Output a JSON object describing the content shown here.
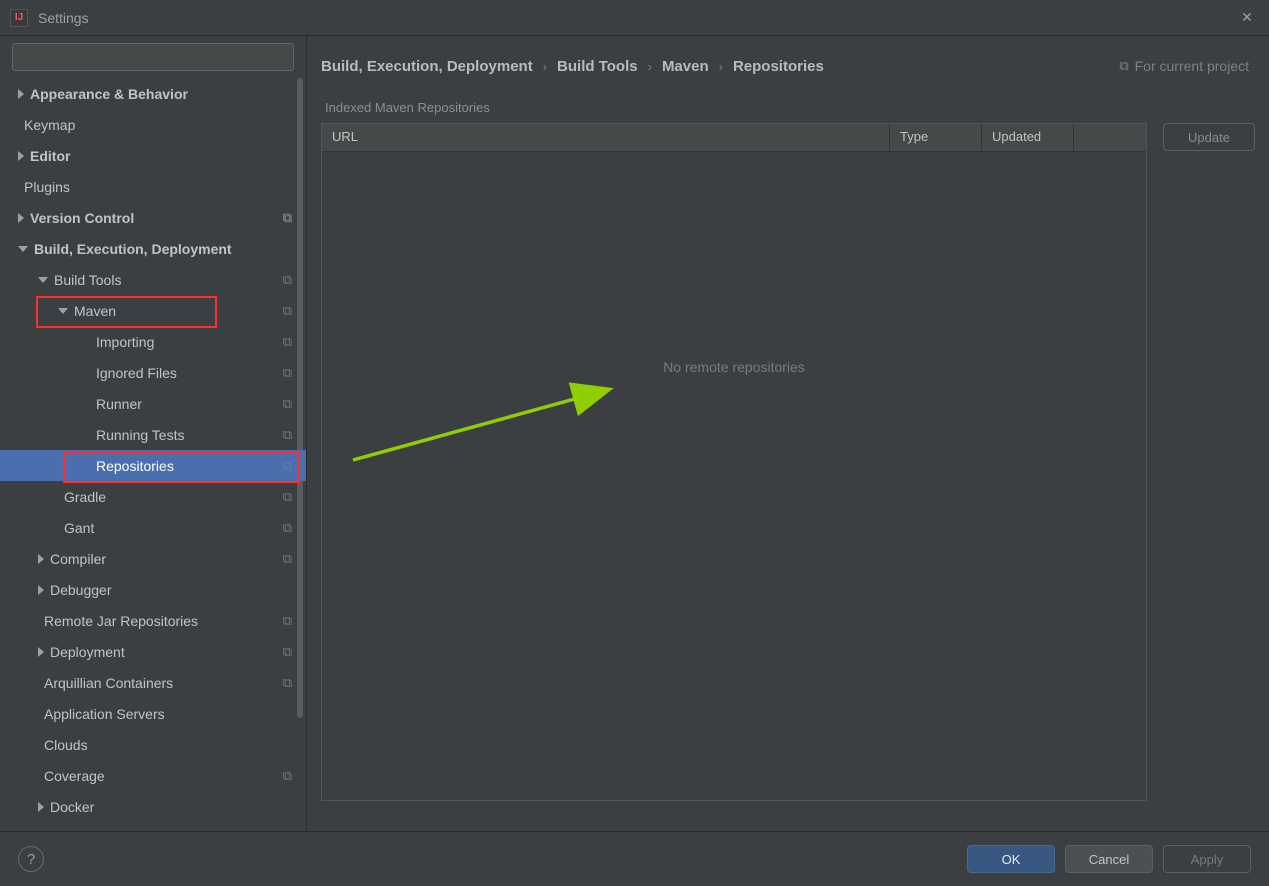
{
  "window": {
    "title": "Settings"
  },
  "search": {
    "placeholder": ""
  },
  "tree": {
    "appearance": "Appearance & Behavior",
    "keymap": "Keymap",
    "editor": "Editor",
    "plugins": "Plugins",
    "vcs": "Version Control",
    "bed": "Build, Execution, Deployment",
    "build_tools": "Build Tools",
    "maven": "Maven",
    "importing": "Importing",
    "ignored": "Ignored Files",
    "runner": "Runner",
    "running_tests": "Running Tests",
    "repositories": "Repositories",
    "gradle": "Gradle",
    "gant": "Gant",
    "compiler": "Compiler",
    "debugger": "Debugger",
    "remote_jar": "Remote Jar Repositories",
    "deployment": "Deployment",
    "arquillian": "Arquillian Containers",
    "app_servers": "Application Servers",
    "clouds": "Clouds",
    "coverage": "Coverage",
    "docker": "Docker"
  },
  "breadcrumbs": {
    "a": "Build, Execution, Deployment",
    "b": "Build Tools",
    "c": "Maven",
    "d": "Repositories",
    "for_project": "For current project"
  },
  "section_title": "Indexed Maven Repositories",
  "columns": {
    "url": "URL",
    "type": "Type",
    "updated": "Updated"
  },
  "empty_text": "No remote repositories",
  "buttons": {
    "update": "Update",
    "ok": "OK",
    "cancel": "Cancel",
    "apply": "Apply"
  }
}
